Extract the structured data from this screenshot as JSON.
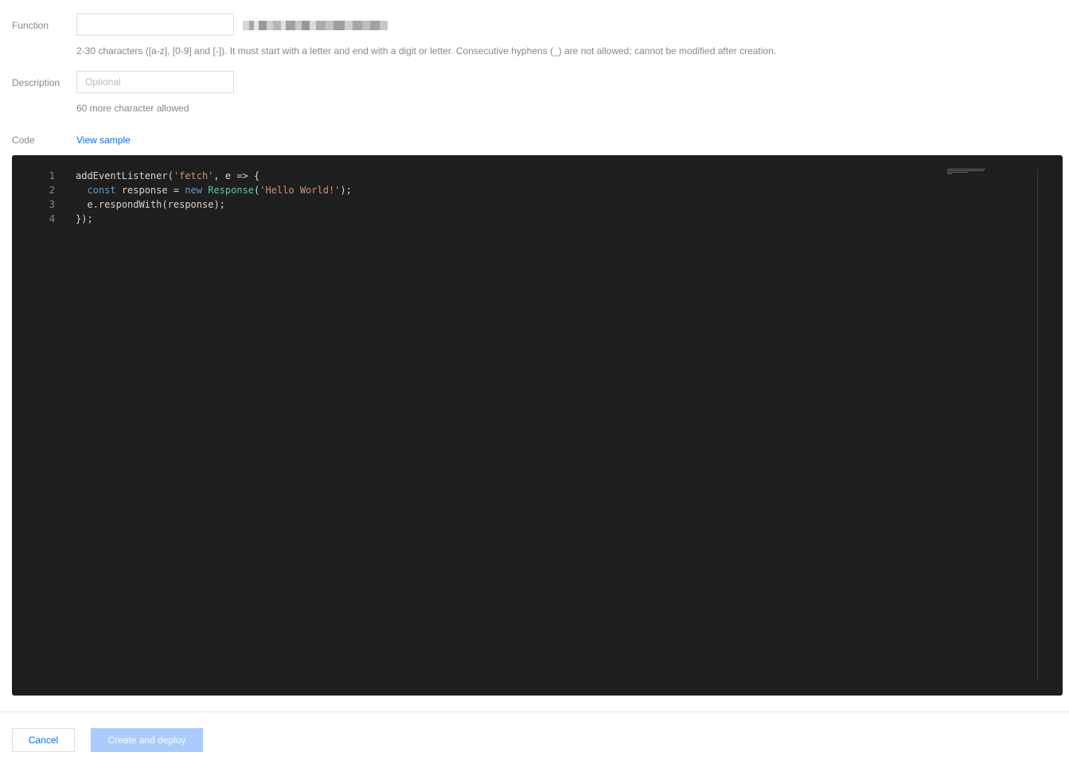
{
  "form": {
    "function": {
      "label": "Function",
      "value": "",
      "placeholder": "",
      "hint": "2-30 characters ([a-z], [0-9] and [-]). It must start with a letter and end with a digit or letter. Consecutive hyphens (_) are not allowed; cannot be modified after creation."
    },
    "description": {
      "label": "Description",
      "value": "",
      "placeholder": "Optional",
      "hint": "60 more character allowed"
    },
    "code": {
      "label": "Code",
      "view_sample_label": "View sample"
    }
  },
  "editor": {
    "lines": [
      {
        "number": "1",
        "text": "addEventListener('fetch', e => {"
      },
      {
        "number": "2",
        "text": "  const response = new Response('Hello World!');"
      },
      {
        "number": "3",
        "text": "  e.respondWith(response);"
      },
      {
        "number": "4",
        "text": "});"
      }
    ],
    "colors": {
      "background": "#1e1e1e",
      "keyword": "#569cd6",
      "string": "#ce9178",
      "class": "#4ec9b0",
      "text": "#d4d4d4",
      "line_number": "#858585"
    }
  },
  "footer": {
    "cancel_label": "Cancel",
    "create_label": "Create and deploy"
  },
  "colors": {
    "accent": "#006eff",
    "primary_disabled": "#a9ccfd"
  }
}
